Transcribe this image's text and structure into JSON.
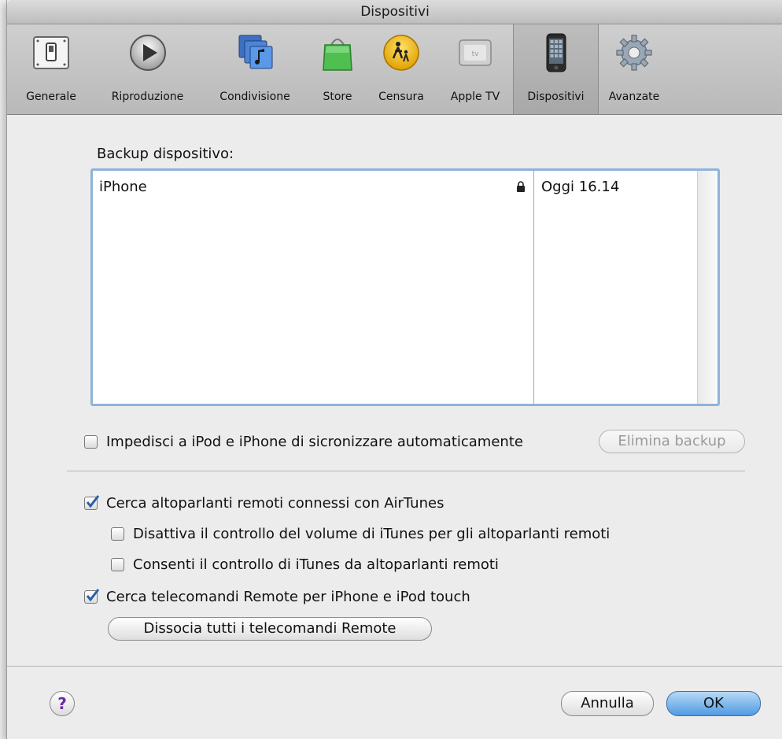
{
  "window": {
    "title": "Dispositivi"
  },
  "toolbar": {
    "items": [
      {
        "label": "Generale",
        "icon": "switch-icon"
      },
      {
        "label": "Riproduzione",
        "icon": "play-icon"
      },
      {
        "label": "Condivisione",
        "icon": "sharing-icon"
      },
      {
        "label": "Store",
        "icon": "shopping-bag-icon"
      },
      {
        "label": "Censura",
        "icon": "parental-icon"
      },
      {
        "label": "Apple TV",
        "icon": "apple-tv-icon"
      },
      {
        "label": "Dispositivi",
        "icon": "iphone-icon",
        "active": true
      },
      {
        "label": "Avanzate",
        "icon": "gear-icon"
      }
    ]
  },
  "backup": {
    "label": "Backup dispositivo:",
    "rows": [
      {
        "device": "iPhone",
        "locked": true,
        "date": "Oggi 16.14"
      }
    ],
    "prevent_sync_label": "Impedisci a iPod e iPhone di sicronizzare automaticamente",
    "prevent_sync_checked": false,
    "delete_button": "Elimina backup"
  },
  "options": {
    "airtunes": {
      "label": "Cerca altoparlanti remoti connessi con AirTunes",
      "checked": true
    },
    "disable_volume": {
      "label": "Disattiva il controllo del volume di iTunes per gli altoparlanti remoti",
      "checked": false
    },
    "allow_control": {
      "label": "Consenti il controllo di iTunes da altoparlanti remoti",
      "checked": false
    },
    "remote": {
      "label": "Cerca telecomandi Remote per iPhone e iPod touch",
      "checked": true
    },
    "dissociate_button": "Dissocia tutti i telecomandi Remote"
  },
  "footer": {
    "help": "?",
    "cancel": "Annulla",
    "ok": "OK"
  },
  "colors": {
    "accent": "#4f9be2",
    "checkmark": "#2b5fa8",
    "selection_border": "#8fb3d9"
  }
}
